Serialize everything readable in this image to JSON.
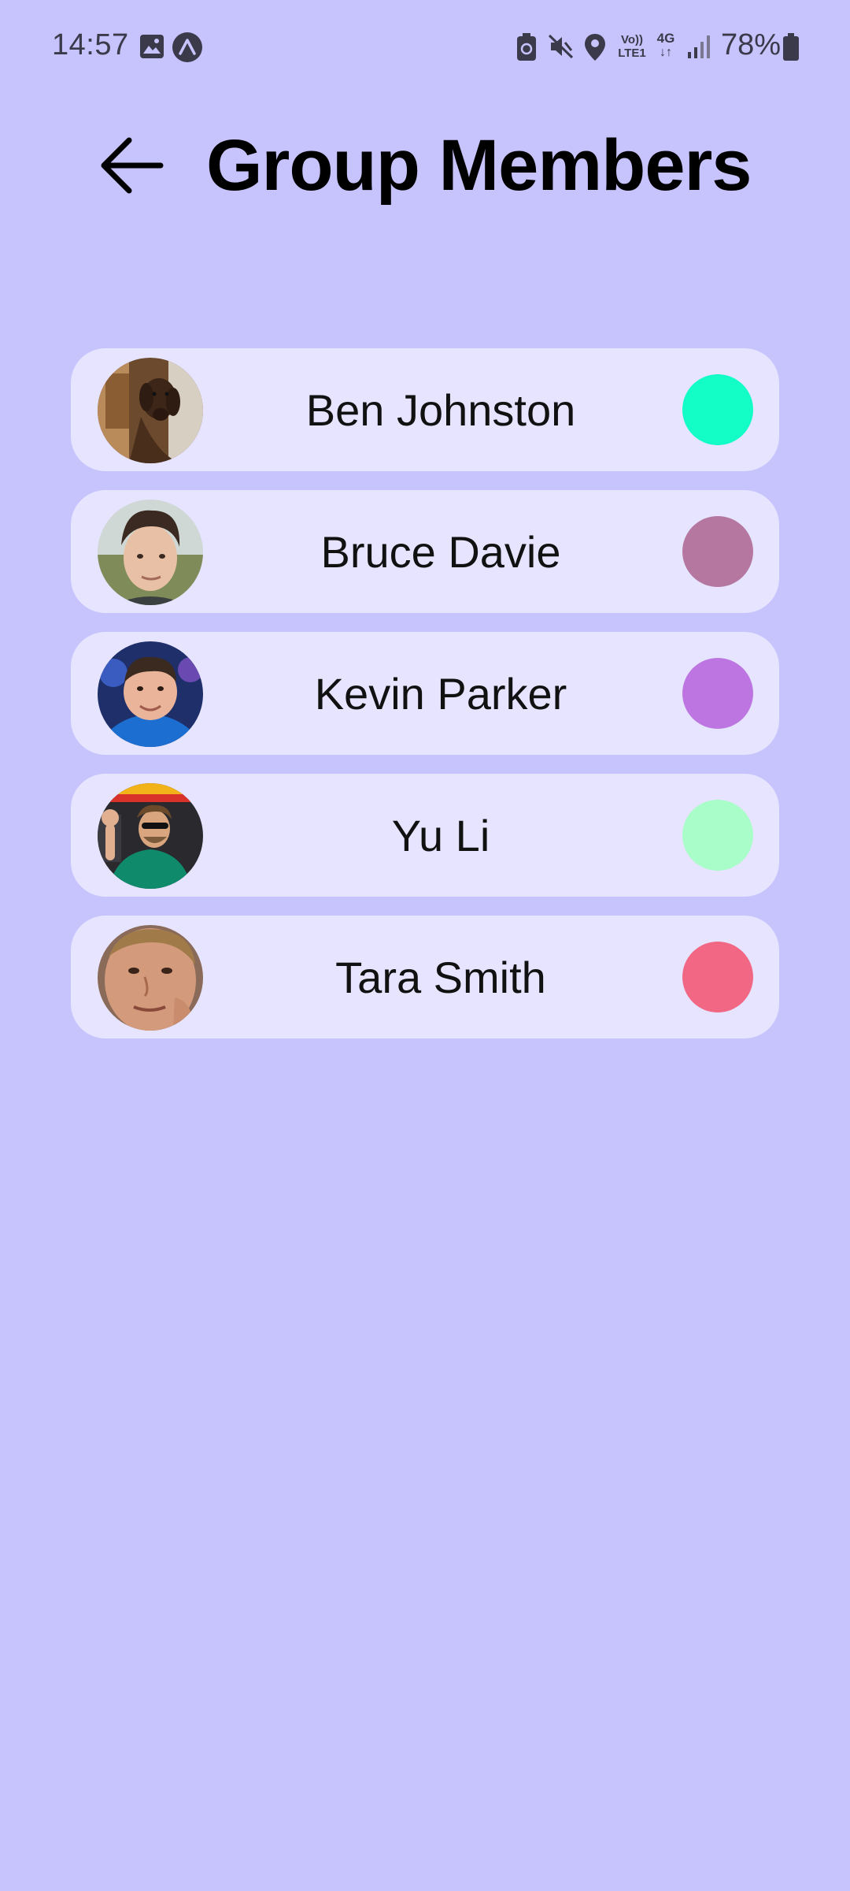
{
  "status_bar": {
    "time": "14:57",
    "battery_percent": "78%",
    "icons": [
      "image-icon",
      "app-notification-icon",
      "battery-saver-icon",
      "mute-icon",
      "location-icon",
      "volte-icon",
      "4g-data-icon",
      "signal-icon",
      "battery-icon"
    ],
    "volte_label_top": "Vo))",
    "volte_label_bottom": "LTE1",
    "network_label": "4G"
  },
  "header": {
    "title": "Group Members",
    "back_icon": "arrow-left-icon"
  },
  "members": [
    {
      "name": "Ben Johnston",
      "status_color": "#13fdc6",
      "avatar": "dog-photo"
    },
    {
      "name": "Bruce Davie",
      "status_color": "#b5779f",
      "avatar": "young-man-photo"
    },
    {
      "name": "Kevin Parker",
      "status_color": "#bd76e1",
      "avatar": "man-blue-shirt-photo"
    },
    {
      "name": "Yu Li",
      "status_color": "#a8fdc8",
      "avatar": "man-green-shirt-waving-photo"
    },
    {
      "name": "Tara Smith",
      "status_color": "#f26884",
      "avatar": "man-closeup-photo"
    }
  ],
  "colors": {
    "background": "#c6c3fd",
    "card": "#e6e4ff"
  }
}
